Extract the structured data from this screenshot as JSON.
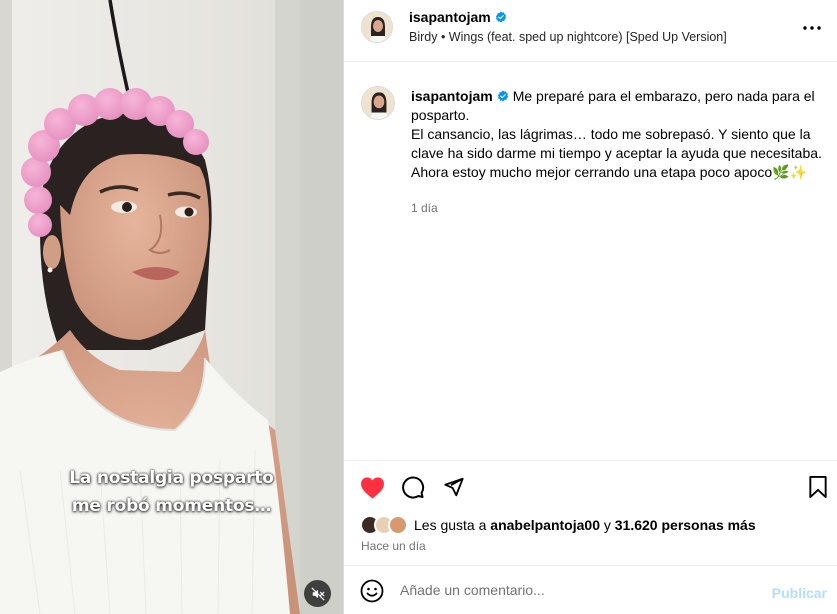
{
  "post": {
    "username": "isapantojam",
    "verified": true,
    "audio": "Birdy • Wings (feat. sped up nightcore) [Sped Up Version]",
    "caption_lines": [
      "Me preparé para el embarazo, pero nada para el posparto.",
      "El cansancio, las lágrimas… todo me sobrepasó. Y siento que la clave ha sido darme mi tiempo y aceptar la ayuda que necesitaba.",
      "Ahora estoy mucho mejor cerrando una etapa poco apoco🌿✨"
    ],
    "caption_time": "1 día",
    "likes_prefix": "Les gusta a",
    "liked_by_user": "anabelpantoja00",
    "likes_connector": "y",
    "likes_others": "31.620 personas más",
    "posted_ago": "Hace un día"
  },
  "video": {
    "overlay_line_1": "La nostalgia posparto",
    "overlay_line_2": "me robó momentos…",
    "muted": true
  },
  "comment_box": {
    "placeholder": "Añade un comentario...",
    "publish_label": "Publicar"
  },
  "colors": {
    "like_red": "#ff3040",
    "verified_blue": "#0095f6",
    "publish_disabled": "#b2dffc",
    "secondary_text": "#737373"
  },
  "icons": {
    "like": "heart-filled-icon",
    "comment": "speech-bubble-icon",
    "share": "paper-plane-icon",
    "save": "bookmark-icon",
    "more": "more-horizontal-icon",
    "emoji": "smiley-icon",
    "mute": "speaker-muted-icon",
    "verified": "verified-badge-icon"
  }
}
